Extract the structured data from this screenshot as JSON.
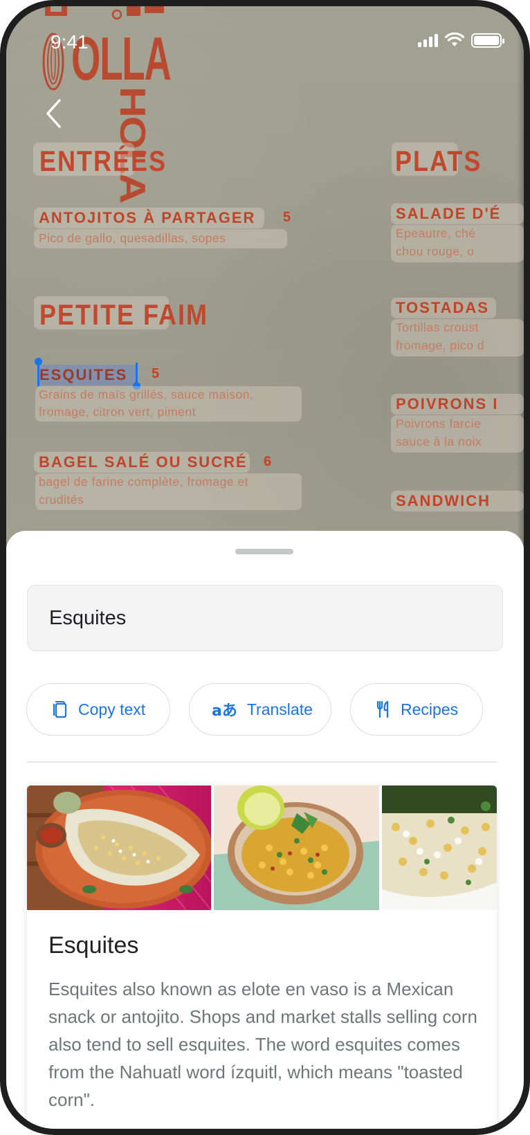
{
  "status_bar": {
    "time": "9:41"
  },
  "logo": {
    "line1": "OLLA",
    "vertical": "HOLA",
    "top_partial": "ɪ ⊙ɢɪɪɑ"
  },
  "menu": {
    "sections": [
      {
        "title": "ENTRÉES"
      },
      {
        "title": "PLATS"
      },
      {
        "title": "PETITE FAIM"
      }
    ],
    "items": [
      {
        "name": "ANTOJITOS À PARTAGER",
        "price": "5",
        "desc": [
          "Pico de gallo, quesadillas, sopes"
        ]
      },
      {
        "name": "ESQUITES",
        "price": "5",
        "desc": [
          "Grains de maïs grillés, sauce maison,",
          "fromage, citron vert, piment"
        ]
      },
      {
        "name": "BAGEL SALÉ OU SUCRÉ",
        "price": "6",
        "desc": [
          "bagel de farine complète, fromage et",
          "crudités"
        ]
      },
      {
        "name": "SALADE D'É",
        "desc": [
          "Epeautre, ché",
          "chou rouge, o"
        ]
      },
      {
        "name": "TOSTADAS",
        "desc": [
          "Tortillas croust",
          "fromage, pico d"
        ]
      },
      {
        "name": "POIVRONS I",
        "desc": [
          "Poivrons farcie",
          "sauce à la noix"
        ]
      },
      {
        "name": "SANDWICH"
      }
    ]
  },
  "sheet": {
    "query": "Esquites",
    "chips": [
      {
        "label": "Copy text",
        "icon": "copy-icon"
      },
      {
        "label": "Translate",
        "icon": "translate-icon"
      },
      {
        "label": "Recipes",
        "icon": "cutlery-icon"
      }
    ],
    "card": {
      "title": "Esquites",
      "description": "Esquites also known as elote en vaso is a Mexican snack or antojito. Shops and market stalls selling corn also tend to sell esquites. The word esquites comes from the Nahuatl word ízquitl, which means \"toasted corn\"."
    }
  },
  "colors": {
    "accent": "#1a73e8",
    "menu_red": "#c0432a",
    "paper": "#9f9d8d"
  }
}
